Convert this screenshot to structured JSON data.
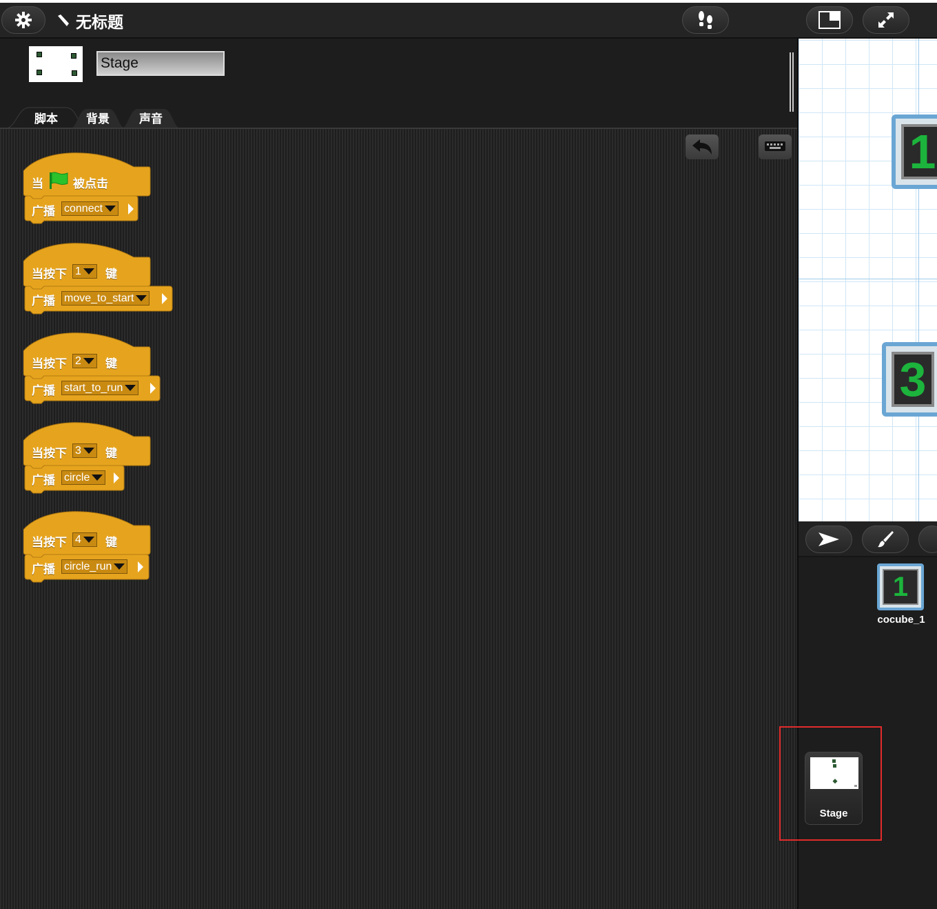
{
  "topbar": {
    "project_title": "无标题",
    "icons": [
      "gear-icon",
      "pencil-icon",
      "footsteps-icon",
      "small-stage-icon",
      "fullscreen-icon"
    ]
  },
  "sprite_header": {
    "name_value": "Stage"
  },
  "tabs": [
    {
      "label": "脚本",
      "active": true
    },
    {
      "label": "背景",
      "active": false
    },
    {
      "label": "声音",
      "active": false
    }
  ],
  "toolbar_icons": [
    "undo-icon",
    "keyboard-icon"
  ],
  "scripts": [
    {
      "hat": {
        "prefix": "当",
        "suffix": "被点击",
        "flag": true
      },
      "command": {
        "label": "广播",
        "message": "connect"
      }
    },
    {
      "hat": {
        "prefix": "当按下",
        "key": "1",
        "suffix": "键"
      },
      "command": {
        "label": "广播",
        "message": "move_to_start"
      }
    },
    {
      "hat": {
        "prefix": "当按下",
        "key": "2",
        "suffix": "键"
      },
      "command": {
        "label": "广播",
        "message": "start_to_run"
      }
    },
    {
      "hat": {
        "prefix": "当按下",
        "key": "3",
        "suffix": "键"
      },
      "command": {
        "label": "广播",
        "message": "circle"
      }
    },
    {
      "hat": {
        "prefix": "当按下",
        "key": "4",
        "suffix": "键"
      },
      "command": {
        "label": "广播",
        "message": "circle_run"
      }
    }
  ],
  "stage": {
    "cubes": [
      "1",
      "3"
    ]
  },
  "sprite_pane": {
    "sprites": [
      {
        "name": "cocube_1",
        "digit": "1"
      }
    ],
    "stage_card_label": "Stage"
  },
  "colors": {
    "block": "#e6a41e",
    "block_dark": "#b47b10",
    "highlight": "#e32b2b",
    "cube_digit": "#1cb43c"
  }
}
